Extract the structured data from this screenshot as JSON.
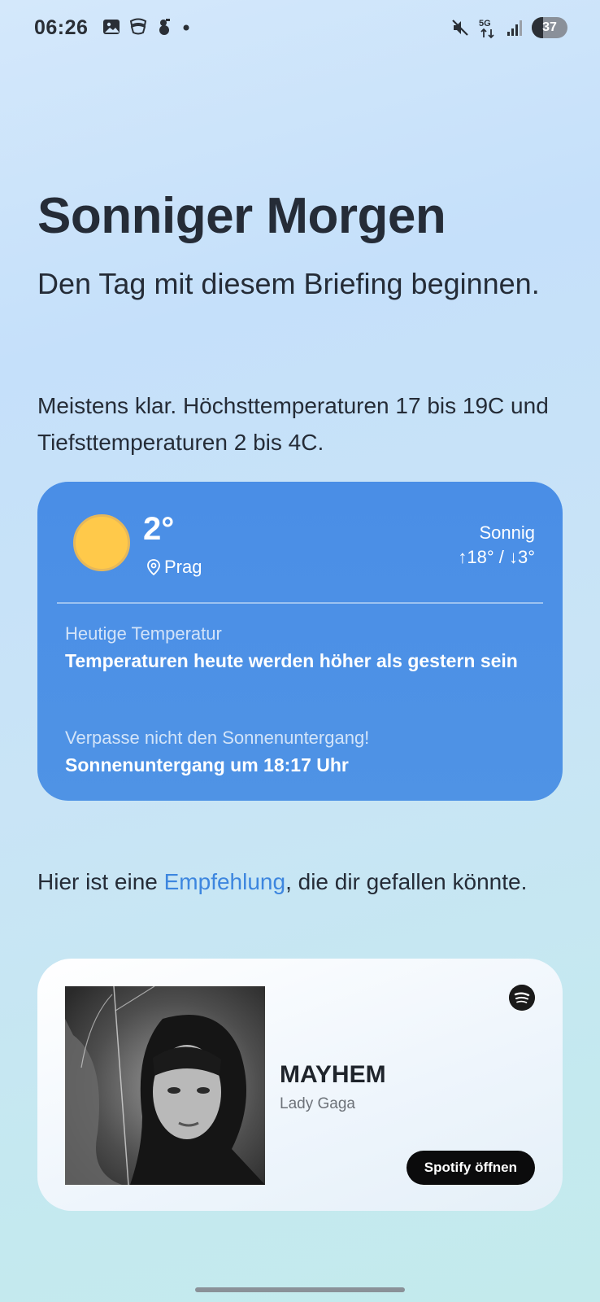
{
  "status_bar": {
    "time": "06:26",
    "battery_level": "37",
    "network": "5G"
  },
  "briefing": {
    "headline": "Sonniger Morgen",
    "subhead": "Den Tag mit diesem Briefing beginnen.",
    "summary": "Meistens klar. Höchsttemperaturen 17 bis 19C und Tiefsttemperaturen 2 bis 4C."
  },
  "weather": {
    "temperature": "2°",
    "location": "Prag",
    "condition": "Sonnig",
    "high_low": "↑18° / ↓3°",
    "today_label": "Heutige Temperatur",
    "today_value": "Temperaturen heute werden höher als gestern sein",
    "sunset_label": "Verpasse nicht den Sonnenuntergang!",
    "sunset_value": "Sonnenuntergang um 18:17 Uhr",
    "colors": {
      "card": "#4a8ee6",
      "sun": "#ffc94a"
    }
  },
  "recommendation": {
    "intro_before": "Hier ist eine ",
    "intro_link": "Empfehlung",
    "intro_after": ", die dir gefallen könnte."
  },
  "music": {
    "title": "MAYHEM",
    "artist": "Lady Gaga",
    "open_label": "Spotify öffnen",
    "service_icon": "spotify-icon"
  }
}
